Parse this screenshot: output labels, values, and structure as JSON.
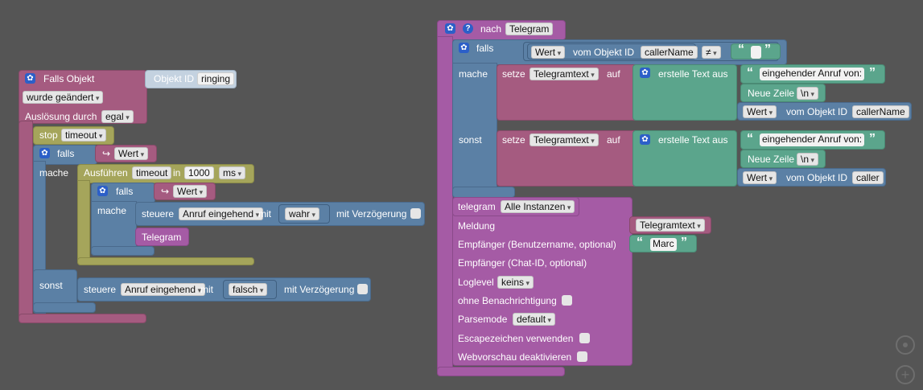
{
  "left": {
    "trigger": {
      "title": "Falls Objekt",
      "object_id_label": "Objekt ID",
      "object_id": "ringing",
      "changed": "wurde geändert",
      "trigger_by_label": "Auslösung durch",
      "trigger_by": "egal"
    },
    "stop": {
      "label": "stop",
      "name": "timeout"
    },
    "if1": {
      "falls": "falls",
      "value": "Wert",
      "mache": "mache",
      "sonst": "sonst"
    },
    "timeout": {
      "label": "Ausführen",
      "name": "timeout",
      "in": "in",
      "ms_value": "1000",
      "unit": "ms"
    },
    "if2": {
      "falls": "falls",
      "value": "Wert",
      "mache": "mache"
    },
    "control1": {
      "label": "steuere",
      "state": "Anruf eingehend",
      "mit": "mit",
      "value": "wahr",
      "delay": "mit Verzögerung"
    },
    "telegram_var": "Telegram",
    "control2": {
      "label": "steuere",
      "state": "Anruf eingehend",
      "mit": "mit",
      "value": "falsch",
      "delay": "mit Verzögerung"
    }
  },
  "right": {
    "trigger": {
      "title": "nach",
      "name": "Telegram"
    },
    "if": {
      "falls": "falls",
      "value": "Wert",
      "from_object": "vom Objekt ID",
      "object": "callerName",
      "op": "≠",
      "empty_text": "",
      "mache": "mache",
      "sonst": "sonst"
    },
    "set1": {
      "label": "setze",
      "var": "Telegramtext",
      "auf": "auf",
      "create_text": "erstelle Text aus",
      "text1": "eingehender Anruf von:",
      "newline_label": "Neue Zeile",
      "newline_value": "\\n",
      "value": "Wert",
      "from_object": "vom Objekt ID",
      "object": "callerName"
    },
    "set2": {
      "label": "setze",
      "var": "Telegramtext",
      "auf": "auf",
      "create_text": "erstelle Text aus",
      "text1": "eingehender Anruf von:",
      "newline_label": "Neue Zeile",
      "newline_value": "\\n",
      "value": "Wert",
      "from_object": "vom Objekt ID",
      "object": "caller"
    },
    "telegram": {
      "label": "telegram",
      "instance": "Alle Instanzen",
      "message_label": "Meldung",
      "message_var": "Telegramtext",
      "recipient_label": "Empfänger (Benutzername, optional)",
      "recipient": "Marc",
      "chat_label": "Empfänger (Chat-ID, optional)",
      "loglevel_label": "Loglevel",
      "loglevel": "keins",
      "silent_label": "ohne Benachrichtigung",
      "parse_label": "Parsemode",
      "parse": "default",
      "escape_label": "Escapezeichen verwenden",
      "preview_label": "Webvorschau deaktivieren"
    }
  },
  "icons": {
    "gear": "gear-icon",
    "help": "help-icon",
    "target": "target-icon",
    "zoom_in": "zoom-in-icon"
  },
  "colors": {
    "background": "#555555",
    "event": "#a55b80",
    "logic": "#5b80a5",
    "timer": "#a5a55b",
    "text": "#5ba58c",
    "telegram": "#a55ba5"
  }
}
